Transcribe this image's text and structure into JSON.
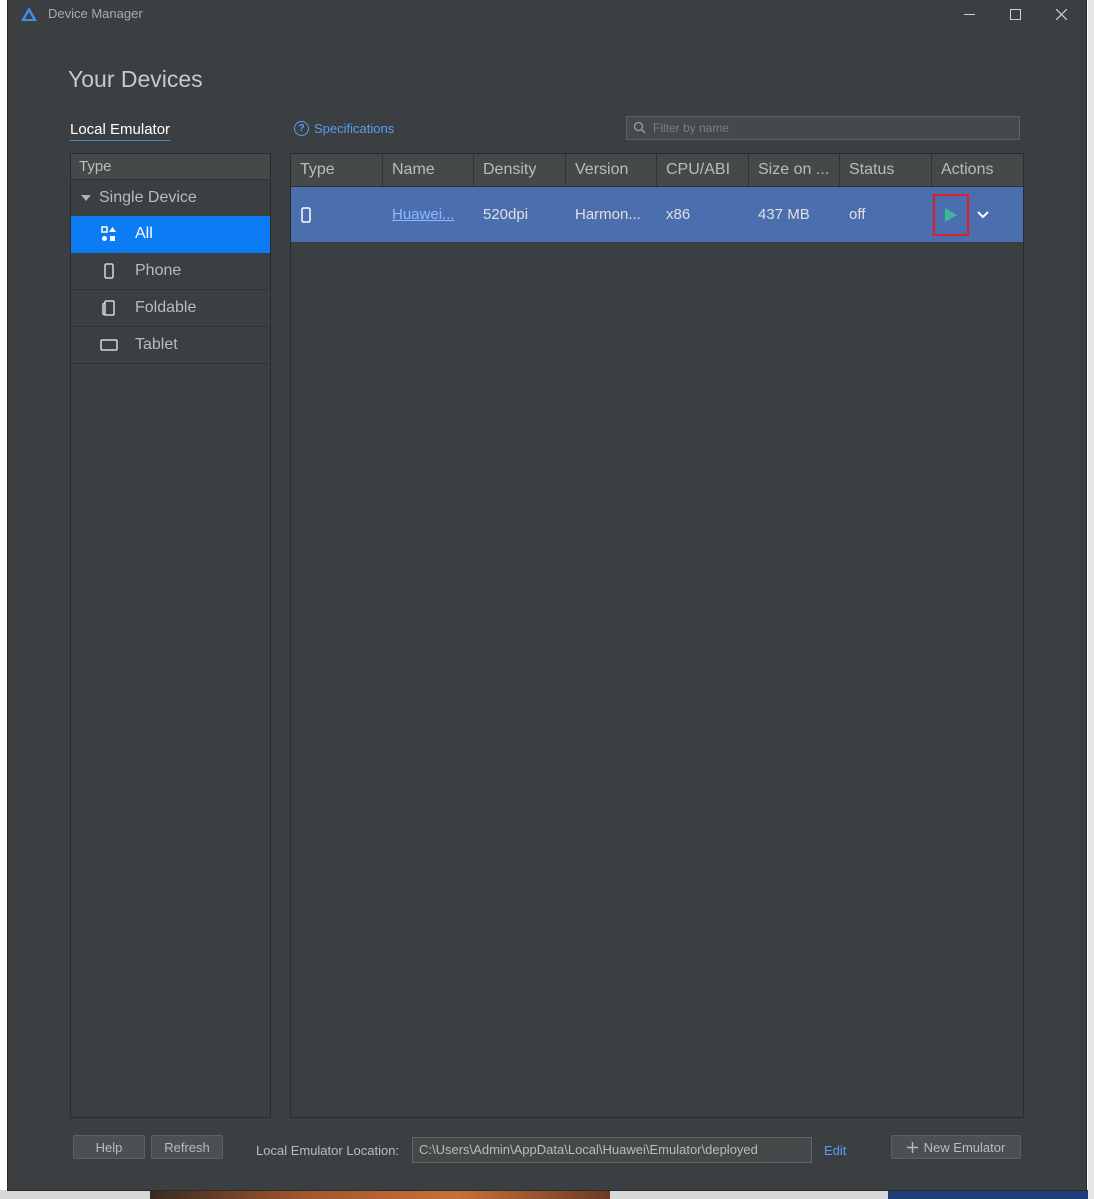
{
  "window": {
    "title": "Device Manager"
  },
  "heading": "Your Devices",
  "tabs": {
    "local": "Local Emulator"
  },
  "specifications_link": "Specifications",
  "filter": {
    "placeholder": "Filter by name",
    "value": ""
  },
  "sidebar": {
    "header": "Type",
    "group": "Single Device",
    "items": [
      {
        "label": "All",
        "icon": "grid-icon",
        "active": true
      },
      {
        "label": "Phone",
        "icon": "phone-icon"
      },
      {
        "label": "Foldable",
        "icon": "foldable-icon"
      },
      {
        "label": "Tablet",
        "icon": "tablet-icon"
      }
    ]
  },
  "table": {
    "columns": [
      "Type",
      "Name",
      "Density",
      "Version",
      "CPU/ABI",
      "Size on ...",
      "Status",
      "Actions"
    ],
    "rows": [
      {
        "type_icon": "phone-icon",
        "name": "Huawei...",
        "density": "520dpi",
        "version": "Harmon...",
        "cpu": "x86",
        "size": "437 MB",
        "status": "off"
      }
    ]
  },
  "footer": {
    "help": "Help",
    "refresh": "Refresh",
    "location_label": "Local Emulator Location:",
    "location_value": "C:\\Users\\Admin\\AppData\\Local\\Huawei\\Emulator\\deployed",
    "edit": "Edit",
    "new_emulator": "New Emulator"
  },
  "colors": {
    "background": "#3c3f41",
    "selection": "#4b6eaf",
    "active_item": "#0c7cf5",
    "link": "#589df6",
    "play": "#3fb69c",
    "highlight_box": "#e02020"
  }
}
